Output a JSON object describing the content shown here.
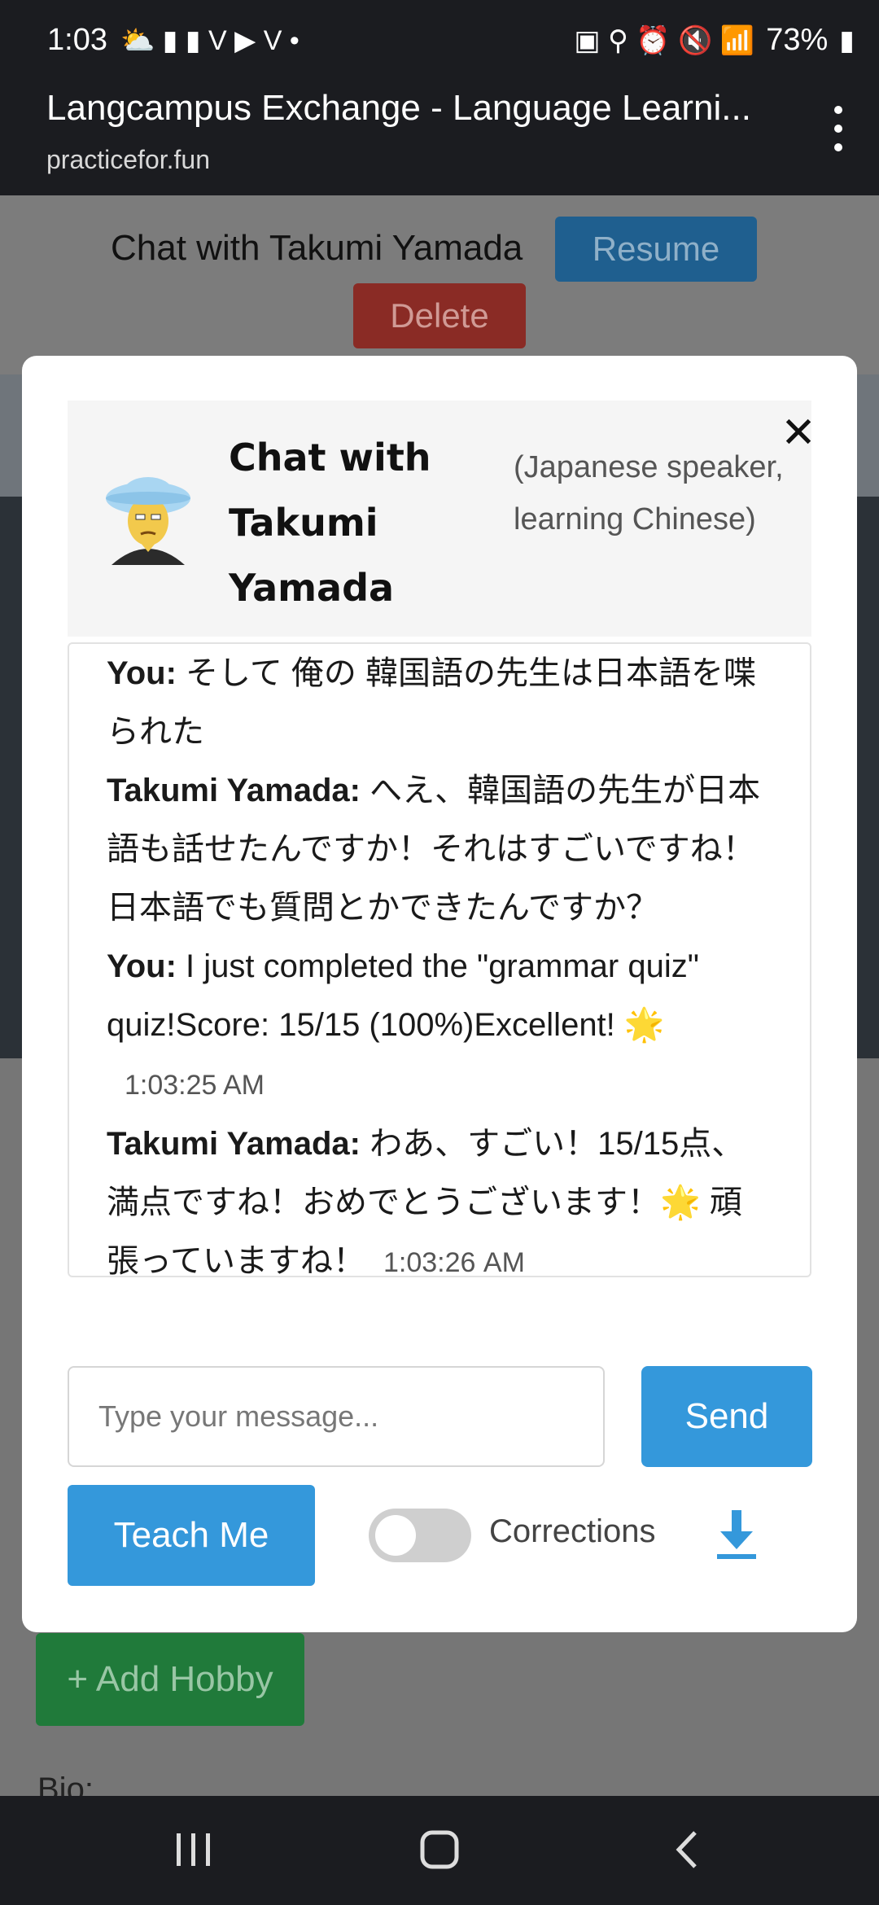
{
  "status_bar": {
    "time": "1:03",
    "battery": "73%"
  },
  "browser": {
    "title": "Langcampus Exchange - Language Learni...",
    "domain": "practicefor.fun"
  },
  "background": {
    "chat_title": "Chat with Takumi Yamada",
    "resume_label": "Resume",
    "delete_label": "Delete",
    "add_hobby_label": "+ Add Hobby",
    "bio_label": "Bio:"
  },
  "modal": {
    "title": "Chat with Takumi Yamada",
    "subtitle": "(Japanese speaker, learning Chinese)",
    "close_symbol": "✕",
    "messages": [
      {
        "sender": "You:",
        "text": " そして 俺の 韓国語の先生は日本語を喋られた",
        "time": ""
      },
      {
        "sender": "Takumi Yamada:",
        "text": " へえ、韓国語の先生が日本語も話せたんですか！それはすごいですね！日本語でも質問とかできたんですか？",
        "time": ""
      },
      {
        "sender": "You:",
        "text": " I just completed the \"grammar quiz\" quiz!Score: 15/15 (100%)Excellent! 🌟",
        "time": "1:03:25 AM"
      },
      {
        "sender": "Takumi Yamada:",
        "text": " わあ、すごい！15/15点、満点ですね！おめでとうございます！🌟 頑張っていますね！",
        "time": "1:03:26 AM"
      }
    ],
    "input_placeholder": "Type your message...",
    "send_label": "Send",
    "teach_label": "Teach Me",
    "corrections_label": "Corrections",
    "corrections_enabled": false
  },
  "colors": {
    "primary": "#3498db",
    "danger": "#c0392b",
    "success": "#27ae60"
  }
}
